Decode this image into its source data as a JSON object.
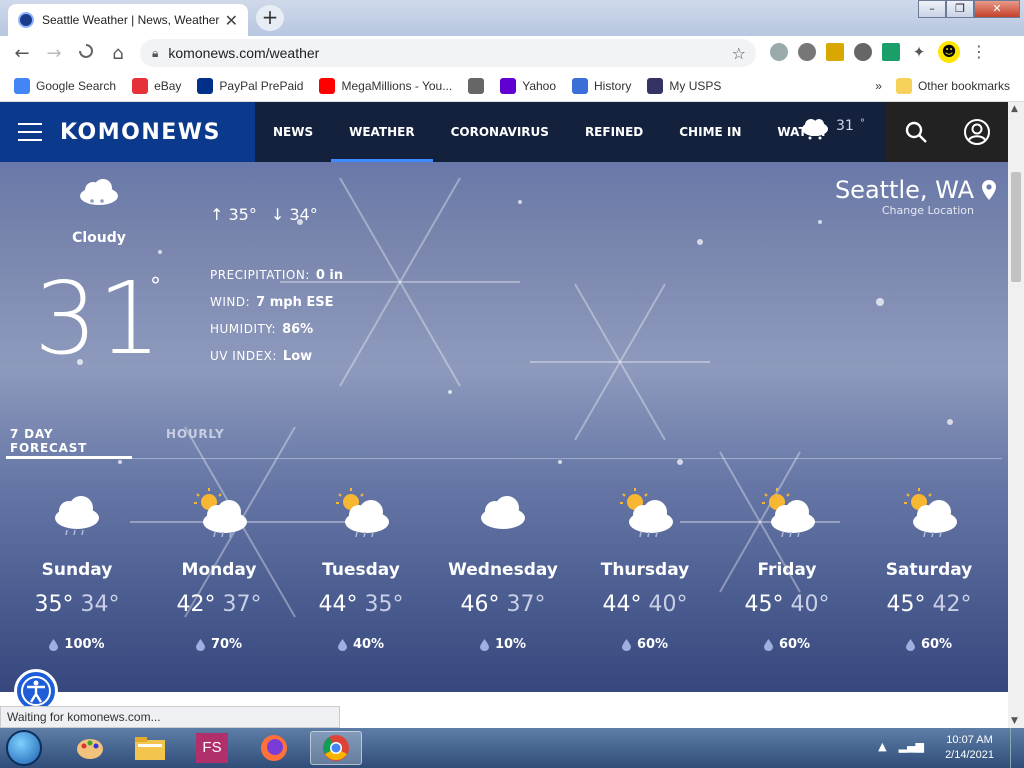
{
  "browser": {
    "tab_title": "Seattle Weather | News, Weather",
    "url": "komonews.com/weather",
    "status_text": "Waiting for komonews.com...",
    "bookmarks": [
      {
        "label": "Google Search",
        "icon": "google-icon",
        "color": "#4285f4"
      },
      {
        "label": "eBay",
        "icon": "ebay-icon",
        "color": "#e53238"
      },
      {
        "label": "PayPal PrePaid",
        "icon": "paypal-icon",
        "color": "#003087"
      },
      {
        "label": "MegaMillions - You...",
        "icon": "youtube-icon",
        "color": "#ff0000"
      },
      {
        "label": "",
        "icon": "globe-icon",
        "color": "#666666"
      },
      {
        "label": "Yahoo",
        "icon": "yahoo-icon",
        "color": "#6001d2"
      },
      {
        "label": "History",
        "icon": "history-icon",
        "color": "#3b6fd8"
      },
      {
        "label": "My USPS",
        "icon": "usps-icon",
        "color": "#333366"
      }
    ],
    "more_bookmarks": "»",
    "other_bookmarks": "Other bookmarks"
  },
  "site": {
    "brand": "KOMONEWS",
    "menu": [
      {
        "label": "NEWS",
        "active": false
      },
      {
        "label": "WEATHER",
        "active": true
      },
      {
        "label": "CORONAVIRUS",
        "active": false
      },
      {
        "label": "REFINED",
        "active": false
      },
      {
        "label": "CHIME IN",
        "active": false
      },
      {
        "label": "WATCH",
        "active": false
      }
    ],
    "nav_temp": "31",
    "nav_temp_deg": "°"
  },
  "current": {
    "condition": "Cloudy",
    "temp": "31",
    "deg": "°",
    "high": "35°",
    "low": "34°",
    "precipitation_label": "PRECIPITATION:",
    "precipitation": "0 in",
    "wind_label": "WIND:",
    "wind": "7 mph ESE",
    "humidity_label": "HUMIDITY:",
    "humidity": "86%",
    "uv_label": "UV INDEX:",
    "uv": "Low",
    "city": "Seattle, WA",
    "change_location": "Change Location"
  },
  "forecast_tabs": [
    {
      "label": "7 DAY FORECAST",
      "active": true
    },
    {
      "label": "HOURLY",
      "active": false
    }
  ],
  "forecast": [
    {
      "day": "Sunday",
      "hi": "35°",
      "lo": "34°",
      "precip": "100%",
      "icon": "cloud-snow-icon"
    },
    {
      "day": "Monday",
      "hi": "42°",
      "lo": "37°",
      "precip": "70%",
      "icon": "sun-cloud-rain-icon"
    },
    {
      "day": "Tuesday",
      "hi": "44°",
      "lo": "35°",
      "precip": "40%",
      "icon": "sun-cloud-rain-icon"
    },
    {
      "day": "Wednesday",
      "hi": "46°",
      "lo": "37°",
      "precip": "10%",
      "icon": "cloud-icon"
    },
    {
      "day": "Thursday",
      "hi": "44°",
      "lo": "40°",
      "precip": "60%",
      "icon": "sun-cloud-rain-icon"
    },
    {
      "day": "Friday",
      "hi": "45°",
      "lo": "40°",
      "precip": "60%",
      "icon": "sun-cloud-rain-icon"
    },
    {
      "day": "Saturday",
      "hi": "45°",
      "lo": "42°",
      "precip": "60%",
      "icon": "sun-cloud-rain-icon"
    }
  ],
  "taskbar": {
    "time": "10:07 AM",
    "date": "2/14/2021",
    "apps": [
      "paint-icon",
      "file-explorer-icon",
      "fs-app-icon",
      "firefox-icon",
      "chrome-icon"
    ],
    "fs_label": "FS"
  }
}
